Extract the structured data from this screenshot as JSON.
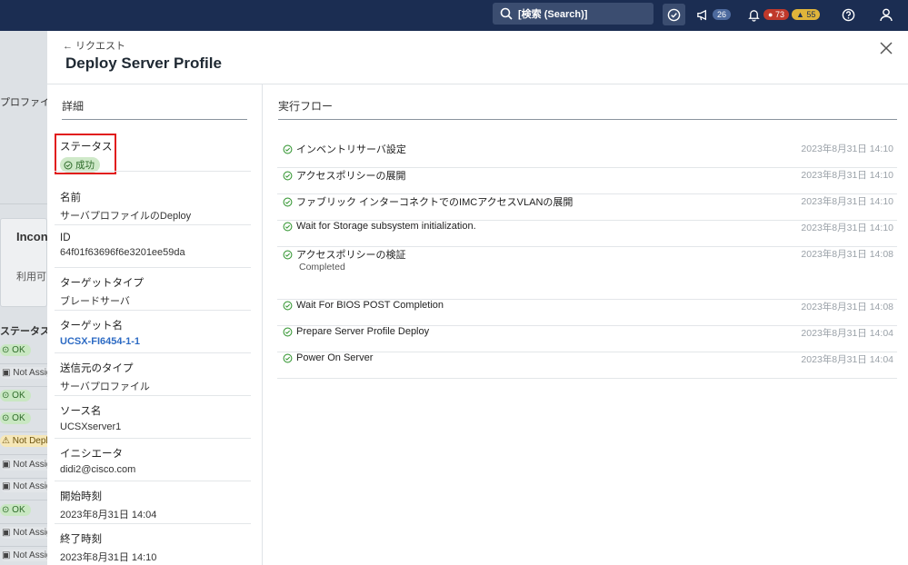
{
  "topbar": {
    "search_placeholder": "[検索 (Search)]",
    "announcements_count": "26",
    "alarms_critical": "73",
    "alarms_warning": "55"
  },
  "background": {
    "side_label": "プロファイ",
    "card_title": "Incons",
    "card_subtitle": "利用可",
    "column_header": "ステータス",
    "rows": [
      {
        "label": "OK",
        "kind": "ok"
      },
      {
        "label": "Not Assig",
        "kind": "na"
      },
      {
        "label": "OK",
        "kind": "ok"
      },
      {
        "label": "OK",
        "kind": "ok"
      },
      {
        "label": "Not Deplo",
        "kind": "nd"
      },
      {
        "label": "Not Assig",
        "kind": "na"
      },
      {
        "label": "Not Assig",
        "kind": "na"
      },
      {
        "label": "OK",
        "kind": "ok"
      },
      {
        "label": "Not Assig",
        "kind": "na"
      },
      {
        "label": "Not Assig",
        "kind": "na"
      }
    ]
  },
  "drawer": {
    "back_label": "← リクエスト",
    "title": "Deploy Server Profile",
    "details_heading": "詳細",
    "flow_heading": "実行フロー",
    "status": {
      "label": "ステータス",
      "value": "成功"
    },
    "fields": [
      {
        "label": "名前",
        "value": "サーバプロファイルのDeploy"
      },
      {
        "label": "ID",
        "value": "64f01f63696f6e3201ee59da"
      },
      {
        "label": "ターゲットタイプ",
        "value": "ブレードサーバ"
      },
      {
        "label": "ターゲット名",
        "value": "UCSX-FI6454-1-1"
      },
      {
        "label": "送信元のタイプ",
        "value": "サーバプロファイル"
      },
      {
        "label": "ソース名",
        "value": "UCSXserver1"
      },
      {
        "label": "イニシエータ",
        "value": "didi2@cisco.com"
      },
      {
        "label": "開始時刻",
        "value": "2023年8月31日 14:04"
      },
      {
        "label": "終了時刻",
        "value": "2023年8月31日 14:10"
      }
    ],
    "flow": [
      {
        "name": "インベントリサーバ設定",
        "time": "2023年8月31日 14:10",
        "sub": ""
      },
      {
        "name": "アクセスポリシーの展開",
        "time": "2023年8月31日 14:10",
        "sub": ""
      },
      {
        "name": "ファブリック インターコネクトでのIMCアクセスVLANの展開",
        "time": "2023年8月31日 14:10",
        "sub": ""
      },
      {
        "name": "Wait for Storage subsystem initialization.",
        "time": "2023年8月31日 14:10",
        "sub": ""
      },
      {
        "name": "アクセスポリシーの検証",
        "time": "2023年8月31日 14:08",
        "sub": "Completed"
      },
      {
        "name": "Wait For BIOS POST Completion",
        "time": "2023年8月31日 14:08",
        "sub": ""
      },
      {
        "name": "Prepare Server Profile Deploy",
        "time": "2023年8月31日 14:04",
        "sub": ""
      },
      {
        "name": "Power On Server",
        "time": "2023年8月31日 14:04",
        "sub": ""
      }
    ]
  }
}
